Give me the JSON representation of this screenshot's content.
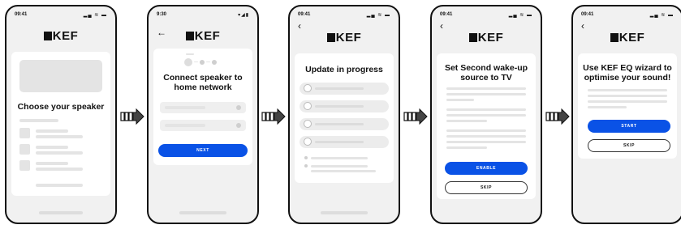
{
  "screens": [
    {
      "time": "09:41",
      "logo": "KEF",
      "title": "Choose your speaker"
    },
    {
      "time": "9:30",
      "logo": "KEF",
      "back": "←",
      "title": "Connect speaker to home network",
      "button": "NEXT"
    },
    {
      "time": "09:41",
      "logo": "KEF",
      "back": "‹",
      "title": "Update in progress"
    },
    {
      "time": "09:41",
      "logo": "KEF",
      "back": "‹",
      "title": "Set Second wake-up source to TV",
      "primary": "ENABLE",
      "secondary": "SKIP"
    },
    {
      "time": "09:41",
      "logo": "KEF",
      "back": "‹",
      "title": "Use KEF EQ wizard to optimise your sound!",
      "primary": "START",
      "secondary": "SKIP"
    }
  ],
  "status_icons": "▂▄ ≋ ▬",
  "colors": {
    "accent": "#0a52e6",
    "background": "#f1f1f1",
    "placeholder": "#e4e4e4"
  }
}
